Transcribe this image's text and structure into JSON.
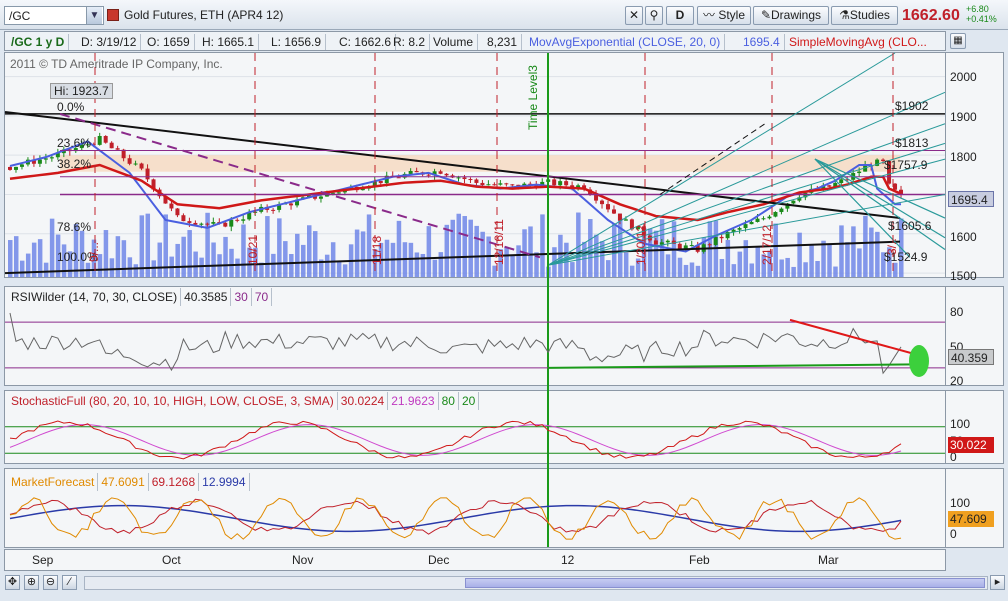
{
  "toolbar": {
    "symbol": "/GC",
    "description": "Gold Futures, ETH (APR4 12)",
    "period_button": "D",
    "style_label": "Style",
    "drawings_label": "Drawings",
    "studies_label": "Studies",
    "last_price": "1662.60",
    "change": "+6.80",
    "change_pct": "+0.41%"
  },
  "infobar": {
    "period": "/GC 1 y D",
    "date": "D: 3/19/12",
    "open": "O: 1659",
    "high": "H: 1665.1",
    "low": "L: 1656.9",
    "close": "C: 1662.6",
    "range": "R: 8.2",
    "volume_label": "Volume",
    "volume": "8,231",
    "ema_label": "MovAvgExponential (CLOSE, 20, 0)",
    "ema_value": "1695.4",
    "sma_label": "SimpleMovingAvg (CLO..."
  },
  "price_panel": {
    "copyright": "2011 © TD Ameritrade IP Company, Inc.",
    "hi_label": "Hi: 1923.7",
    "fib_levels": [
      "0.0%",
      "23.6%",
      "38.2%",
      "78.6%",
      "100.0%"
    ],
    "right_levels": [
      "$1902",
      "$1813",
      "$1757.9",
      "$1605.6",
      "$1524.9"
    ],
    "time_level": "Time Level3",
    "date_markers": [
      "10/21",
      "11/18",
      "12/16/11",
      "1/20/12",
      "2/17/12",
      "9/...",
      "3/.."
    ],
    "y_ticks": [
      "2000",
      "1900",
      "1800",
      "1700",
      "1600",
      "1500"
    ],
    "current_value": "1695.4",
    "colors": {
      "up": "#1a8a1a",
      "down": "#c0202a",
      "ema": "#4a5fe0",
      "sma": "#d01818",
      "volume": "#6f86e8",
      "fib_band": "#e8a060"
    }
  },
  "rsi": {
    "title": "RSIWilder (14, 70, 30, CLOSE)",
    "value": "40.3585",
    "oversold": "30",
    "overbought": "70",
    "y_ticks": [
      "80",
      "50",
      "20"
    ],
    "current": "40.359"
  },
  "stoch": {
    "title": "StochasticFull (80, 20, 10, 10, HIGH, LOW, CLOSE, 3, SMA)",
    "k": "30.0224",
    "d": "21.9623",
    "upper": "80",
    "lower": "20",
    "y_ticks": [
      "100",
      "50",
      "0"
    ],
    "current": "30.022"
  },
  "forecast": {
    "title": "MarketForecast",
    "v1": "47.6091",
    "v2": "69.1268",
    "v3": "12.9994",
    "y_ticks": [
      "100",
      "50",
      "0"
    ],
    "current": "47.609"
  },
  "x_axis": [
    "Sep",
    "Oct",
    "Nov",
    "Dec",
    "12",
    "Feb",
    "Mar"
  ]
}
